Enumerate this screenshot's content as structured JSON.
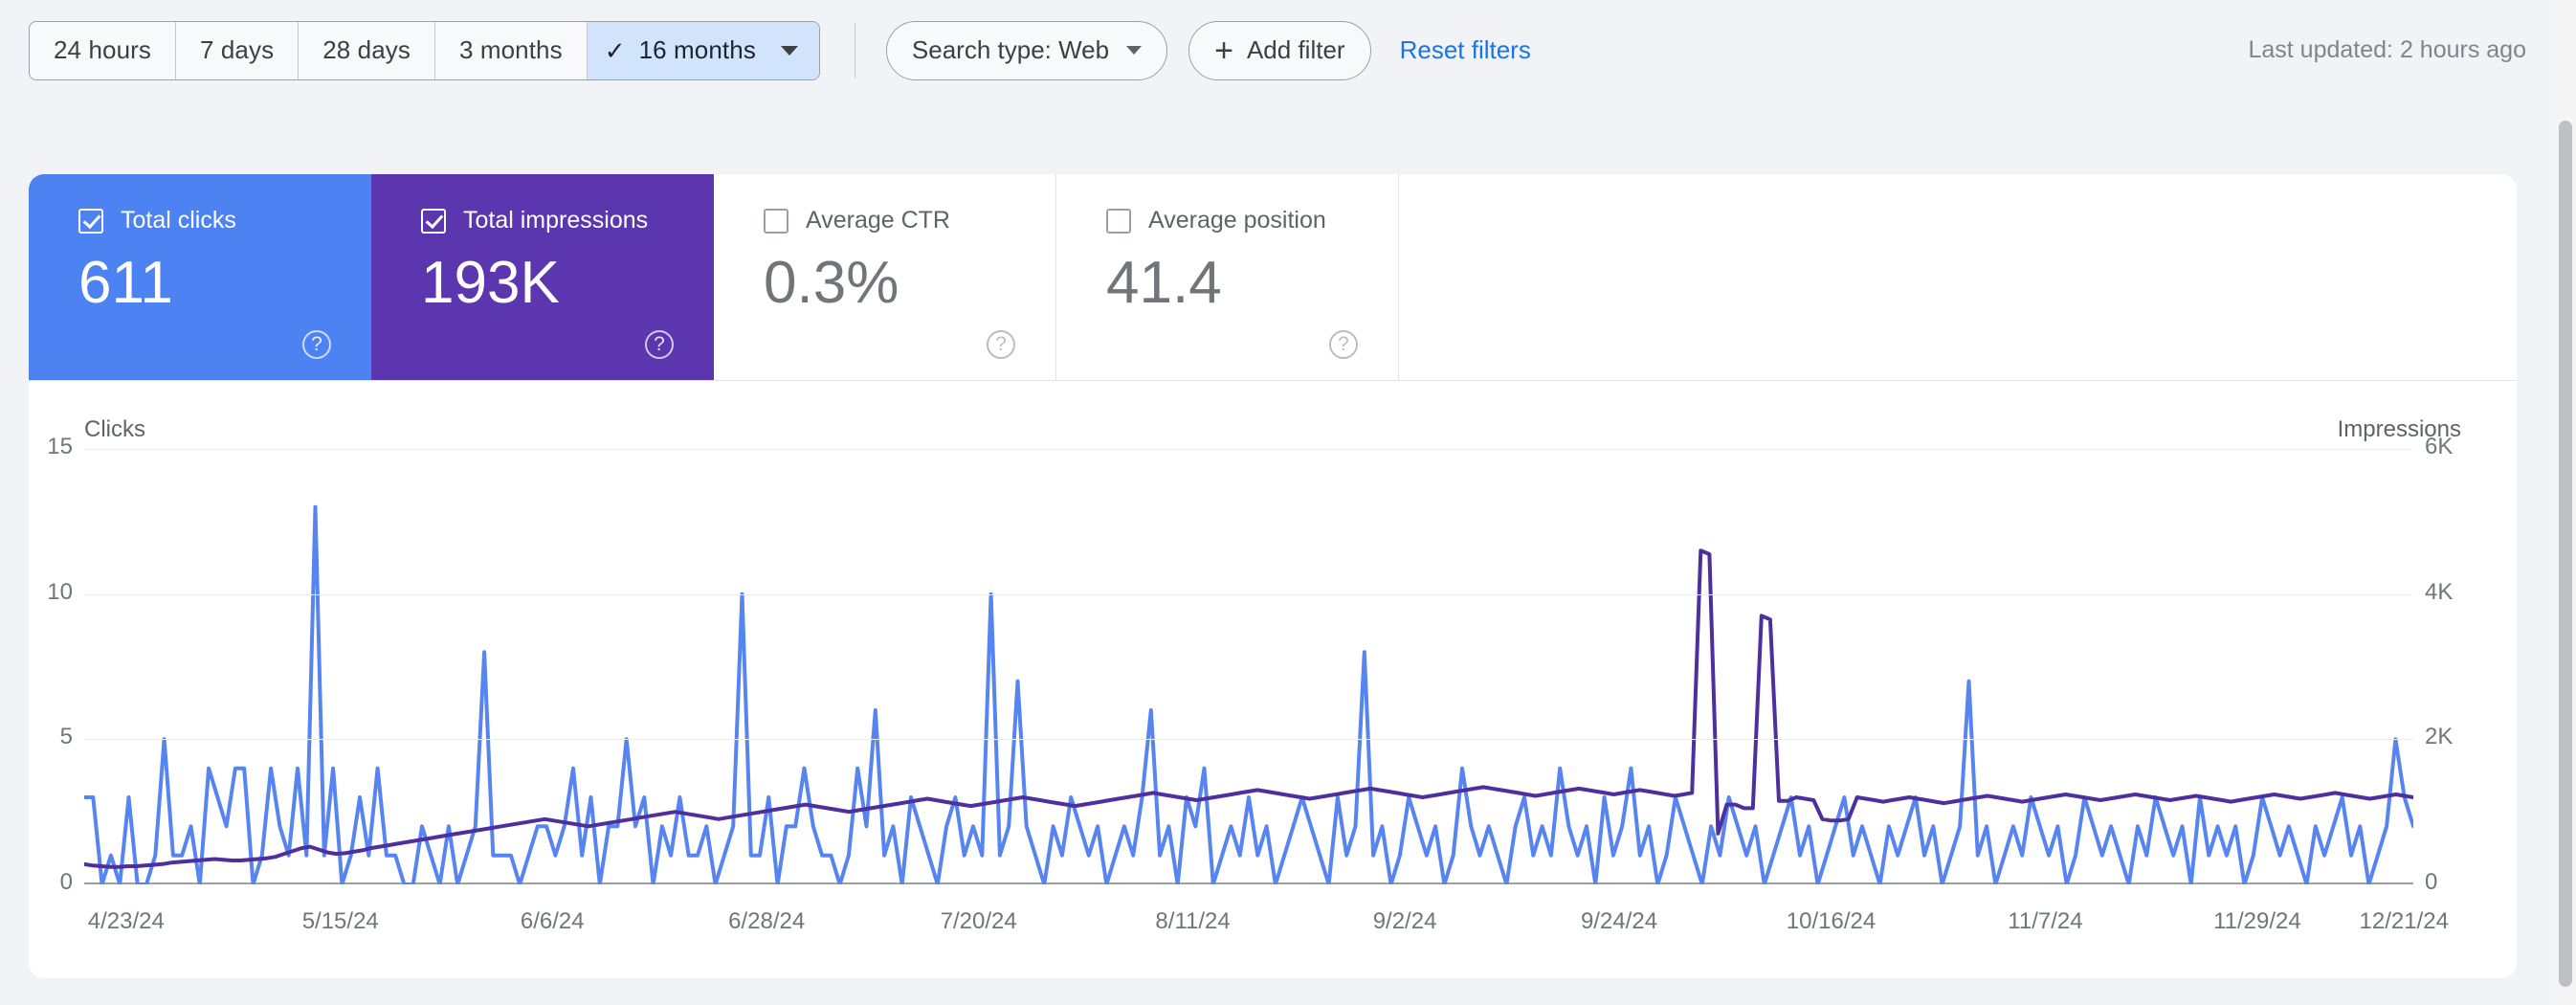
{
  "toolbar": {
    "date_ranges": [
      {
        "label": "24 hours",
        "active": false
      },
      {
        "label": "7 days",
        "active": false
      },
      {
        "label": "28 days",
        "active": false
      },
      {
        "label": "3 months",
        "active": false
      },
      {
        "label": "16 months",
        "active": true
      }
    ],
    "active_check_glyph": "✓",
    "search_type": "Search type: Web",
    "add_filter": "Add filter",
    "add_filter_glyph": "+",
    "reset_filters": "Reset filters",
    "last_updated": "Last updated: 2 hours ago"
  },
  "metrics": [
    {
      "label": "Total clicks",
      "value": "611",
      "checked": true,
      "theme": "blue",
      "help_glyph": "?"
    },
    {
      "label": "Total impressions",
      "value": "193K",
      "checked": true,
      "theme": "purple",
      "help_glyph": "?"
    },
    {
      "label": "Average CTR",
      "value": "0.3%",
      "checked": false,
      "theme": "plain",
      "help_glyph": "?"
    },
    {
      "label": "Average position",
      "value": "41.4",
      "checked": false,
      "theme": "plain",
      "help_glyph": "?"
    }
  ],
  "colors": {
    "clicks_card": "#4D82F3",
    "impressions_card": "#5B36AE",
    "clicks_line": "#5684F0",
    "impressions_line": "#4E2F9E",
    "accent_link": "#1A73E8",
    "active_range_bg": "#D2E3FC",
    "page_bg": "#F1F3F7",
    "surface_bg": "#FFFFFF",
    "gridline": "#EBEDEF",
    "baseline": "#9AA0A6"
  },
  "chart_data": {
    "type": "line",
    "title": "",
    "xlabel": "",
    "grid": true,
    "legend": "none",
    "left_axis": {
      "label": "Clicks",
      "ticks": [
        "0",
        "5",
        "10",
        "15"
      ],
      "ylim": [
        0,
        15
      ]
    },
    "right_axis": {
      "label": "Impressions",
      "ticks": [
        "0",
        "2K",
        "4K",
        "6K"
      ],
      "ylim": [
        0,
        6000
      ]
    },
    "x_tick_labels": [
      "4/23/24",
      "5/15/24",
      "6/6/24",
      "6/28/24",
      "7/20/24",
      "8/11/24",
      "9/2/24",
      "9/24/24",
      "10/16/24",
      "11/7/24",
      "11/29/24",
      "12/21/24"
    ],
    "x_tick_positions_pct": [
      1.8,
      11.0,
      20.1,
      29.3,
      38.4,
      47.6,
      56.7,
      65.9,
      75.0,
      84.2,
      93.3,
      99.6
    ],
    "series": [
      {
        "name": "Clicks",
        "axis": "left",
        "color": "#5684F0",
        "values": [
          3,
          3,
          0,
          1,
          0,
          3,
          0,
          0,
          1,
          5,
          1,
          1,
          2,
          0,
          4,
          3,
          2,
          4,
          4,
          0,
          1,
          4,
          2,
          1,
          4,
          1,
          13,
          1,
          4,
          0,
          1,
          3,
          1,
          4,
          1,
          1,
          0,
          0,
          2,
          1,
          0,
          2,
          0,
          1,
          2,
          8,
          1,
          1,
          1,
          0,
          1,
          2,
          2,
          1,
          2,
          4,
          1,
          3,
          0,
          2,
          2,
          5,
          2,
          3,
          0,
          2,
          1,
          3,
          1,
          1,
          2,
          0,
          1,
          2,
          10,
          1,
          1,
          3,
          0,
          2,
          2,
          4,
          2,
          1,
          1,
          0,
          1,
          4,
          2,
          6,
          1,
          2,
          0,
          3,
          2,
          1,
          0,
          2,
          3,
          1,
          2,
          1,
          10,
          1,
          2,
          7,
          2,
          1,
          0,
          2,
          1,
          3,
          2,
          1,
          2,
          0,
          1,
          2,
          1,
          3,
          6,
          1,
          2,
          0,
          3,
          2,
          4,
          0,
          1,
          2,
          1,
          3,
          1,
          2,
          0,
          1,
          2,
          3,
          2,
          1,
          0,
          3,
          1,
          2,
          8,
          1,
          2,
          0,
          1,
          3,
          2,
          1,
          2,
          0,
          1,
          4,
          2,
          1,
          2,
          1,
          0,
          2,
          3,
          1,
          2,
          1,
          4,
          2,
          1,
          2,
          0,
          3,
          1,
          2,
          4,
          1,
          2,
          0,
          1,
          3,
          2,
          1,
          0,
          2,
          1,
          3,
          2,
          1,
          2,
          0,
          1,
          2,
          3,
          1,
          2,
          0,
          1,
          2,
          3,
          1,
          2,
          1,
          0,
          2,
          1,
          2,
          3,
          1,
          2,
          0,
          1,
          2,
          7,
          1,
          2,
          0,
          1,
          2,
          1,
          3,
          2,
          1,
          2,
          0,
          1,
          3,
          2,
          1,
          2,
          1,
          0,
          2,
          1,
          3,
          2,
          1,
          2,
          0,
          3,
          1,
          2,
          1,
          2,
          0,
          1,
          3,
          2,
          1,
          2,
          1,
          0,
          2,
          1,
          2,
          3,
          1,
          2,
          0,
          1,
          2,
          5,
          3,
          2
        ],
        "max": 13
      },
      {
        "name": "Impressions",
        "axis": "right",
        "color": "#4E2F9E",
        "values": [
          280,
          260,
          250,
          240,
          240,
          250,
          250,
          260,
          270,
          280,
          300,
          310,
          320,
          330,
          340,
          350,
          340,
          330,
          330,
          340,
          350,
          360,
          380,
          420,
          460,
          500,
          520,
          480,
          440,
          420,
          430,
          450,
          470,
          500,
          520,
          540,
          560,
          580,
          600,
          620,
          640,
          660,
          680,
          700,
          720,
          740,
          760,
          780,
          800,
          820,
          840,
          860,
          880,
          900,
          880,
          860,
          840,
          820,
          800,
          820,
          840,
          860,
          880,
          900,
          920,
          940,
          960,
          980,
          1000,
          980,
          960,
          940,
          920,
          900,
          920,
          940,
          960,
          980,
          1000,
          1020,
          1040,
          1060,
          1080,
          1100,
          1080,
          1060,
          1040,
          1020,
          1000,
          1020,
          1040,
          1060,
          1080,
          1100,
          1120,
          1140,
          1160,
          1180,
          1160,
          1140,
          1120,
          1100,
          1080,
          1100,
          1120,
          1140,
          1160,
          1180,
          1200,
          1180,
          1160,
          1140,
          1120,
          1100,
          1080,
          1100,
          1120,
          1140,
          1160,
          1180,
          1200,
          1220,
          1240,
          1260,
          1240,
          1220,
          1200,
          1180,
          1160,
          1180,
          1200,
          1220,
          1240,
          1260,
          1280,
          1300,
          1280,
          1260,
          1240,
          1220,
          1200,
          1180,
          1200,
          1220,
          1240,
          1260,
          1280,
          1300,
          1320,
          1300,
          1280,
          1260,
          1240,
          1220,
          1200,
          1220,
          1240,
          1260,
          1280,
          1300,
          1320,
          1340,
          1320,
          1300,
          1280,
          1260,
          1240,
          1220,
          1240,
          1260,
          1280,
          1300,
          1320,
          1300,
          1280,
          1260,
          1240,
          1260,
          1280,
          1300,
          1280,
          1260,
          1240,
          1220,
          1240,
          1260,
          4600,
          4550,
          700,
          1100,
          1100,
          1050,
          1050,
          3700,
          3650,
          1150,
          1150,
          1200,
          1180,
          1160,
          900,
          880,
          880,
          900,
          1200,
          1180,
          1160,
          1140,
          1160,
          1180,
          1200,
          1180,
          1160,
          1140,
          1120,
          1140,
          1160,
          1180,
          1200,
          1220,
          1200,
          1180,
          1160,
          1140,
          1160,
          1180,
          1200,
          1220,
          1240,
          1220,
          1200,
          1180,
          1160,
          1180,
          1200,
          1220,
          1240,
          1220,
          1200,
          1180,
          1160,
          1180,
          1200,
          1220,
          1200,
          1180,
          1160,
          1140,
          1160,
          1180,
          1200,
          1220,
          1240,
          1220,
          1200,
          1180,
          1200,
          1220,
          1240,
          1260,
          1240,
          1220,
          1200,
          1180,
          1200,
          1220,
          1240,
          1220,
          1200
        ],
        "max": 4600
      }
    ]
  },
  "scrollbar": {
    "name": "vertical-scrollbar"
  }
}
